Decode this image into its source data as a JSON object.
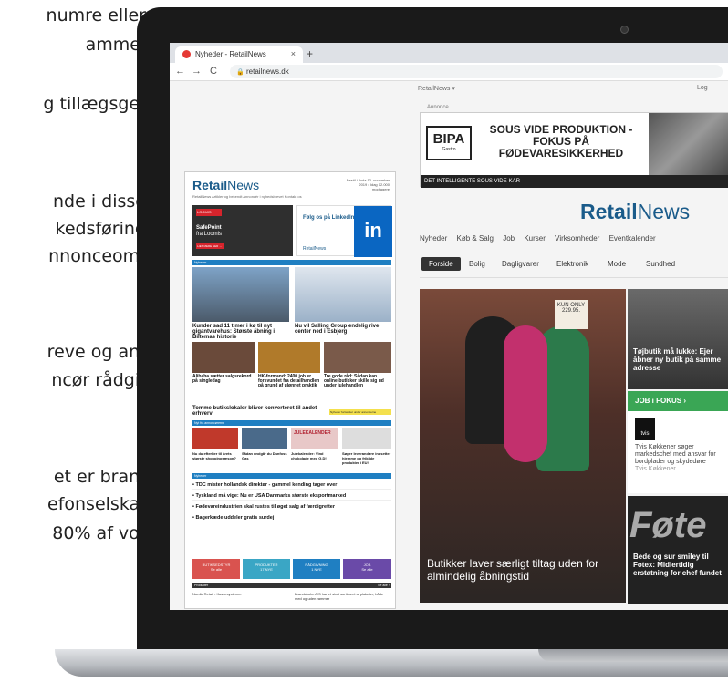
{
  "left_text": [
    "numre eller",
    "amme.",
    "g tillægsge-",
    "nde i disse",
    "kedsføring",
    "nnonceom-",
    "reve og an-",
    "ncør rådgi-",
    "et er bran-",
    "efonselska-",
    "80% af vo-"
  ],
  "browser": {
    "tab_title": "Nyheder - RetailNews",
    "tab_close": "×",
    "new_tab": "+",
    "url": "retailnews.dk",
    "back": "←",
    "forward": "→",
    "reload": "C"
  },
  "site": {
    "util": "RetailNews ▾",
    "login": "Log",
    "annonce": "Annonce",
    "logo_a": "Retail",
    "logo_b": "News"
  },
  "ad": {
    "brand": "BIPA",
    "brand_sub": "Gastro",
    "headline": "SOUS VIDE PRODUKTION - FOKUS PÅ FØDEVARESIKKERHED",
    "bar": "DET INTELLIGENTE SOUS VIDE-KAR"
  },
  "mainnav": [
    "Nyheder",
    "Køb & Salg",
    "Job",
    "Kurser",
    "Virksomheder",
    "Eventkalender"
  ],
  "subnav": [
    "Forside",
    "Bolig",
    "Dagligvarer",
    "Elektronik",
    "Mode",
    "Sundhed"
  ],
  "hero": {
    "sign": "KUN ONLY 229.95.",
    "caption": "Butikker laver særligt tiltag uden for almindelig åbningstid"
  },
  "side1": {
    "caption": "Tøjbutik må lukke: Ejer åbner ny butik på samme adresse"
  },
  "job": {
    "header": "JOB i FOKUS ›",
    "logo": "tvis",
    "text": "Tvis Køkkener søger markedschef med ansvar for bordplader og skydedøre",
    "company": "Tvis Køkkener"
  },
  "side2": {
    "big": "Føte",
    "caption": "Bede og sur smiley til Fotex: Midlertidig erstatning for chef fundet"
  },
  "newsletter": {
    "logo_a": "Retail",
    "logo_b": "News",
    "date": "Bestil i Juda 12. november 2019 • Idag 12.000 modtagere",
    "menu": "RetailNews   Artikler og bekendt   Annoncér i nyhedsbrevet   Kontakt os",
    "loomis": "LOOMIS",
    "safepoint": "SafePoint",
    "loomis_sub": "fra Loomis",
    "read_more": "LÆS MERE HER →",
    "follow": "Følg os på LinkedIn",
    "in": "in",
    "brand_small": "RetailNews",
    "sec1": "Nyheder",
    "h1": "Kunder sad 11 timer i kø til nyt gigantvarehus: Største åbning i Biltemas historie",
    "h2": "Nu vil Salling Group endelig rive center ned i Esbjerg",
    "s1": "Alibaba sætter salgsrekord på singledag",
    "s2": "HK-formand: 2400 job er forsvundet fra detailhandlen på grund af ulønnet praktik",
    "s3": "Tre gode råd: Sådan kan online-butikker skille sig ud under julehandlen",
    "h3": "Tomme butikslokaler bliver konverteret til andet erhverv",
    "tag": "Nyheder fortsætter under annoncerne",
    "sec2": "Nyt fra annoncørerne",
    "julekal": "JULEKALENDER",
    "a1": "Nu du efterlter til årets største shoppingsæson?",
    "a2": "Sådan undgår du Danfoss Gas",
    "a3": "Julekalender: Vind chokolade med G.D!",
    "a4": "Søger leverandøre indsetter hjemme og frikilde produkter i EU!",
    "sec3": "Nyheder",
    "l1": "TDC mister hollandsk direktør - gammel kending tager over",
    "l2": "Tyskland må vige: Nu er USA Danmarks største eksportmarked",
    "l3": "Fødevareindustrien skal rustes til øget salg af færdigretter",
    "l4": "Bagerkæde uddeler gratis surdej",
    "foot": [
      {
        "t": "BUTIKSEDSTYR",
        "s": "Se alle"
      },
      {
        "t": "PRODUKTER",
        "s": "17 NYE"
      },
      {
        "t": "RÅDGIVNING",
        "s": "1 NYE"
      },
      {
        "t": "JOB",
        "s": "Se alle"
      }
    ],
    "produkter": "Produkter",
    "se_alle": "Se alle ›",
    "nordic": "Nordic Retail - Kassesystemer",
    "bottom_text": "Brandsholm A/S har et stort sortiment af plakater, både med og uden rammer"
  },
  "colors": {
    "accent": "#1a5b8a",
    "green": "#3aa655",
    "linkedin": "#0a66c2",
    "loomis": "#d6242c"
  }
}
